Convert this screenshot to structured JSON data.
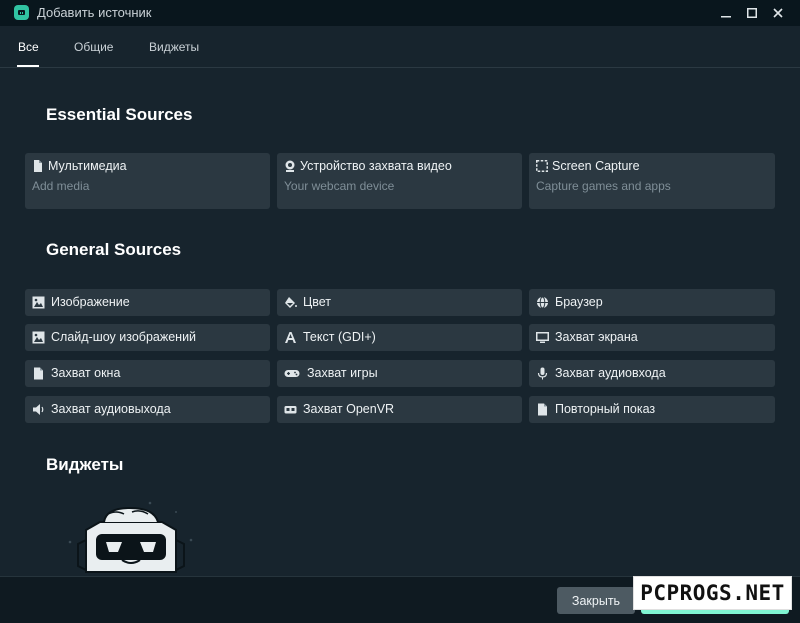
{
  "window": {
    "title": "Добавить источник",
    "minimize_icon": "minimize-icon",
    "maximize_icon": "maximize-icon",
    "close_icon": "close-icon"
  },
  "tabs": [
    {
      "label": "Все",
      "active": true
    },
    {
      "label": "Общие",
      "active": false
    },
    {
      "label": "Виджеты",
      "active": false
    }
  ],
  "essential": {
    "title": "Essential Sources",
    "items": [
      {
        "icon": "file-icon",
        "label": "Мультимедиа",
        "desc": "Add media"
      },
      {
        "icon": "webcam-icon",
        "label": "Устройство захвата видео",
        "desc": "Your webcam device"
      },
      {
        "icon": "screen-capture-icon",
        "label": "Screen Capture",
        "desc": "Capture games and apps"
      }
    ]
  },
  "general": {
    "title": "General Sources",
    "items": [
      {
        "icon": "image-icon",
        "label": "Изображение"
      },
      {
        "icon": "paint-bucket-icon",
        "label": "Цвет"
      },
      {
        "icon": "globe-icon",
        "label": "Браузер"
      },
      {
        "icon": "image-icon",
        "label": "Слайд-шоу изображений"
      },
      {
        "icon": "text-icon",
        "label": "Текст (GDI+)"
      },
      {
        "icon": "monitor-icon",
        "label": "Захват экрана"
      },
      {
        "icon": "file-icon",
        "label": "Захват окна"
      },
      {
        "icon": "gamepad-icon",
        "label": "Захват игры"
      },
      {
        "icon": "microphone-icon",
        "label": "Захват аудиовхода"
      },
      {
        "icon": "speaker-icon",
        "label": "Захват аудиовыхода"
      },
      {
        "icon": "vr-headset-icon",
        "label": "Захват OpenVR"
      },
      {
        "icon": "file-icon",
        "label": "Повторный показ"
      }
    ]
  },
  "widgets": {
    "title": "Виджеты"
  },
  "footer": {
    "close_label": "Закрыть"
  },
  "watermark": {
    "text": "PCPROGS.NET"
  },
  "colors": {
    "background": "#17242d",
    "card": "#2b3841",
    "accent": "#80f5d2",
    "titlebar": "#09161d"
  }
}
